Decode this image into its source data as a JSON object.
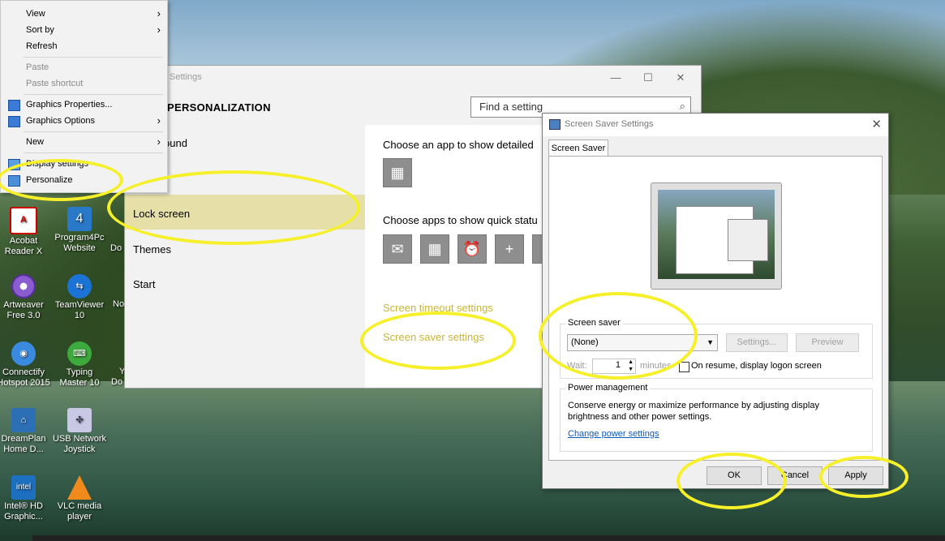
{
  "context_menu": {
    "items": [
      {
        "label": "View",
        "arrow": true,
        "disabled": false
      },
      {
        "label": "Sort by",
        "arrow": true,
        "disabled": false
      },
      {
        "label": "Refresh",
        "arrow": false,
        "disabled": false
      },
      {
        "label": "Paste",
        "arrow": false,
        "disabled": true
      },
      {
        "label": "Paste shortcut",
        "arrow": false,
        "disabled": true
      },
      {
        "label": "Graphics Properties...",
        "arrow": false,
        "disabled": false,
        "icon": "graphics-icon"
      },
      {
        "label": "Graphics Options",
        "arrow": true,
        "disabled": false,
        "icon": "graphics-icon"
      },
      {
        "label": "New",
        "arrow": true,
        "disabled": false
      },
      {
        "label": "Display settings",
        "arrow": false,
        "disabled": false,
        "icon": "display-icon"
      },
      {
        "label": "Personalize",
        "arrow": false,
        "disabled": false,
        "icon": "personalize-icon"
      }
    ]
  },
  "settings": {
    "title": "Settings",
    "heading": "PERSONALIZATION",
    "search_placeholder": "Find a setting",
    "nav": {
      "item1": "ound",
      "item2": "Lock screen",
      "item3": "Themes",
      "item4": "Start"
    },
    "main": {
      "detailed_label": "Choose an app to show detailed",
      "quick_label": "Choose apps to show quick statu",
      "screen_timeout_link": "Screen timeout settings",
      "screen_saver_link": "Screen saver settings"
    }
  },
  "screen_saver_dialog": {
    "title": "Screen Saver Settings",
    "tab": "Screen Saver",
    "group_label": "Screen saver",
    "selected": "(None)",
    "settings_button": "Settings...",
    "preview_button": "Preview",
    "wait_label": "Wait:",
    "wait_value": "1",
    "minutes_label": "minutes",
    "resume_label": "On resume, display logon screen",
    "power_label": "Power management",
    "power_text_1": "Conserve energy or maximize performance by adjusting display",
    "power_text_2": "brightness and other power settings.",
    "power_link": "Change power settings",
    "ok_button": "OK",
    "cancel_button": "Cancel",
    "apply_button": "Apply"
  },
  "desktop_icons": {
    "acrobat": [
      "Acobat",
      "Reader X"
    ],
    "program4pc": [
      "Program4Pc",
      "Website"
    ],
    "artweaver": [
      "Artweaver",
      "Free 3.0"
    ],
    "teamviewer": [
      "TeamViewer",
      "10"
    ],
    "connectify": [
      "Connectify",
      "Hotspot 2015"
    ],
    "typing": [
      "Typing",
      "Master 10"
    ],
    "dreamplan": [
      "DreamPlan",
      "Home D..."
    ],
    "usbjoystick": [
      "USB Network",
      "Joystick"
    ],
    "intel": [
      "Intel® HD",
      "Graphic..."
    ],
    "vlc": [
      "VLC media",
      "player"
    ],
    "partial": [
      "No",
      "Do",
      "No",
      "Y",
      "Do"
    ]
  },
  "colors": {
    "highlight": "#f5f02a",
    "lock_screen_selection": "#e6dfa8",
    "accent_link": "#c9b53a"
  }
}
